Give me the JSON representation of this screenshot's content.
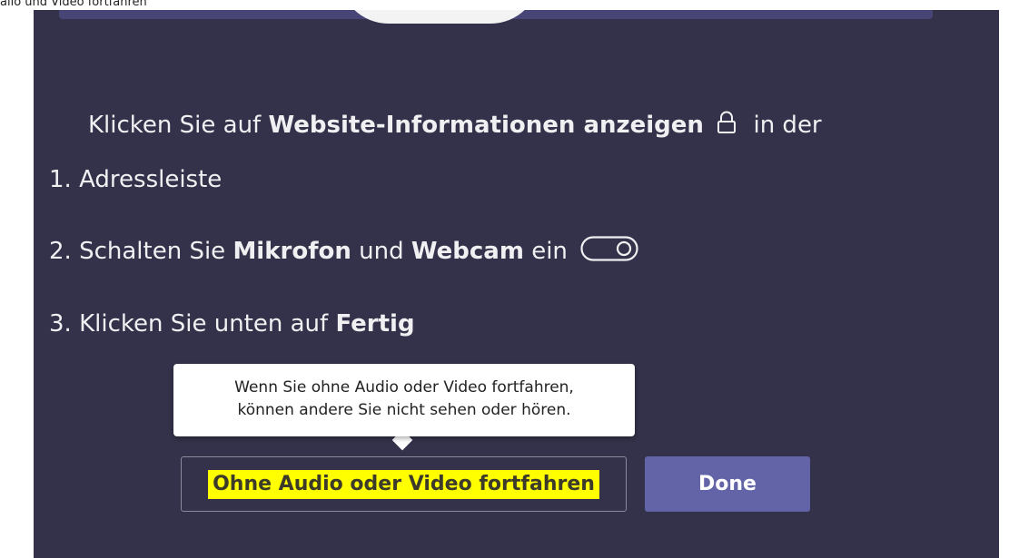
{
  "page_caption": "alio und Video fortfahren",
  "instructions": {
    "step1": {
      "text_before": "Klicken Sie auf ",
      "bold": "Website-Informationen anzeigen",
      "text_after": "in der",
      "number": "1.",
      "continuation": "Adressleiste",
      "icon": "lock-icon"
    },
    "step2": {
      "number": "2.",
      "text_before": "Schalten Sie ",
      "bold1": "Mikrofon",
      "middle": " und ",
      "bold2": "Webcam",
      "text_after": " ein",
      "icon": "toggle-icon"
    },
    "step3": {
      "number": "3.",
      "text_before": "Klicken Sie unten auf ",
      "bold": "Fertig"
    }
  },
  "tooltip": {
    "line1": "Wenn Sie ohne Audio oder Video fortfahren,",
    "line2": "können andere Sie nicht sehen oder hören."
  },
  "buttons": {
    "continue_label": "Ohne Audio oder Video fortfahren",
    "done_label": "Done"
  },
  "colors": {
    "panel_bg": "#33324a",
    "accent": "#6264a7",
    "highlight": "#ffff00",
    "banner": "#464576"
  }
}
